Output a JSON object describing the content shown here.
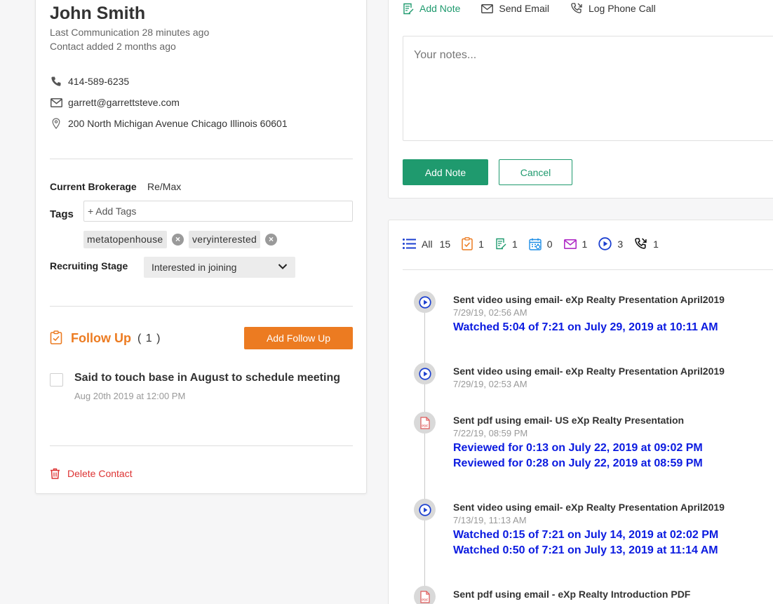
{
  "contact": {
    "name": "John Smith",
    "last_communication": "Last Communication 28 minutes ago",
    "contact_added": "Contact added 2 months ago",
    "phone": "414-589-6235",
    "email": "garrett@garrettsteve.com",
    "address": "200 North Michigan Avenue Chicago Illinois 60601"
  },
  "details": {
    "brokerage_label": "Current Brokerage",
    "brokerage_value": "Re/Max",
    "tags_label": "Tags",
    "tags_placeholder": "+ Add Tags",
    "tags": [
      "metatopenhouse",
      "veryinterested"
    ],
    "stage_label": "Recruiting Stage",
    "stage_value": "Interested in joining"
  },
  "follow_up": {
    "title": "Follow Up",
    "count": "( 1 )",
    "add_button": "Add Follow Up",
    "items": [
      {
        "text": "Said to touch base in August to schedule meeting",
        "date": "Aug 20th 2019 at 12:00 PM"
      }
    ]
  },
  "delete_label": "Delete Contact",
  "notes": {
    "tabs": [
      {
        "label": "Add Note",
        "icon": "note-edit-icon",
        "active": true
      },
      {
        "label": "Send Email",
        "icon": "envelope-icon",
        "active": false
      },
      {
        "label": "Log Phone Call",
        "icon": "phone-call-icon",
        "active": false
      }
    ],
    "placeholder": "Your notes...",
    "add_button": "Add Note",
    "cancel_button": "Cancel"
  },
  "activity_filters": [
    {
      "icon": "list-icon",
      "label": "All",
      "count": "15"
    },
    {
      "icon": "clipboard-icon",
      "label": "",
      "count": "1"
    },
    {
      "icon": "note-edit-icon",
      "label": "",
      "count": "1"
    },
    {
      "icon": "calendar-icon",
      "label": "",
      "count": "0"
    },
    {
      "icon": "envelope-icon",
      "label": "",
      "count": "1"
    },
    {
      "icon": "play-circle-icon",
      "label": "",
      "count": "3"
    },
    {
      "icon": "phone-call-icon",
      "label": "",
      "count": "1"
    }
  ],
  "activities": [
    {
      "type": "video",
      "title": "Sent video using email- eXp Realty Presentation April2019",
      "date": "7/29/19, 02:56 AM",
      "events": [
        "Watched 5:04 of 7:21 on July 29, 2019 at 10:11 AM"
      ]
    },
    {
      "type": "video",
      "title": "Sent video using email- eXp Realty Presentation April2019",
      "date": "7/29/19, 02:53 AM",
      "events": []
    },
    {
      "type": "pdf",
      "title": "Sent pdf using email- US eXp Realty Presentation",
      "date": "7/22/19, 08:59 PM",
      "events": [
        "Reviewed for 0:13 on July 22, 2019 at 09:02 PM",
        "Reviewed for 0:28 on July 22, 2019 at 08:59 PM"
      ]
    },
    {
      "type": "video",
      "title": "Sent video using email- eXp Realty Presentation April2019",
      "date": "7/13/19, 11:13 AM",
      "events": [
        "Watched 0:15 of 7:21 on July 14, 2019 at 02:02 PM",
        "Watched 0:50 of 7:21 on July 13, 2019 at 11:14 AM"
      ]
    },
    {
      "type": "pdf",
      "title": "Sent pdf using email - eXp Realty Introduction PDF",
      "date": "",
      "events": []
    }
  ],
  "colors": {
    "green": "#1f9a6e",
    "orange": "#ec7b21",
    "link_blue": "#0b1be0",
    "delete_red": "#dd3333"
  }
}
